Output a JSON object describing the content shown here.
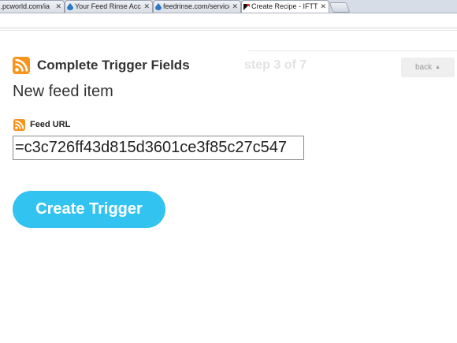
{
  "browser": {
    "tabs": [
      {
        "label": ":.pcworld.com/ia",
        "close": "✕",
        "active": false
      },
      {
        "label": "Your Feed Rinse Acco",
        "close": "✕",
        "active": false
      },
      {
        "label": "feedrinse.com/service",
        "close": "✕",
        "active": false
      },
      {
        "label": "Create Recipe - IFTTT",
        "close": "✕",
        "active": true
      }
    ]
  },
  "page": {
    "heading": "Complete Trigger Fields",
    "step": "step 3 of 7",
    "back_label": "back",
    "back_caret": "▲",
    "subtitle": "New feed item",
    "field": {
      "label": "Feed URL",
      "value": "=c3c726ff43d815d3601ce3f85c27c547"
    },
    "create_button": "Create Trigger"
  },
  "colors": {
    "accent": "#33c3f0",
    "rss": "#f7941d",
    "step_text": "#e2e2e2"
  }
}
